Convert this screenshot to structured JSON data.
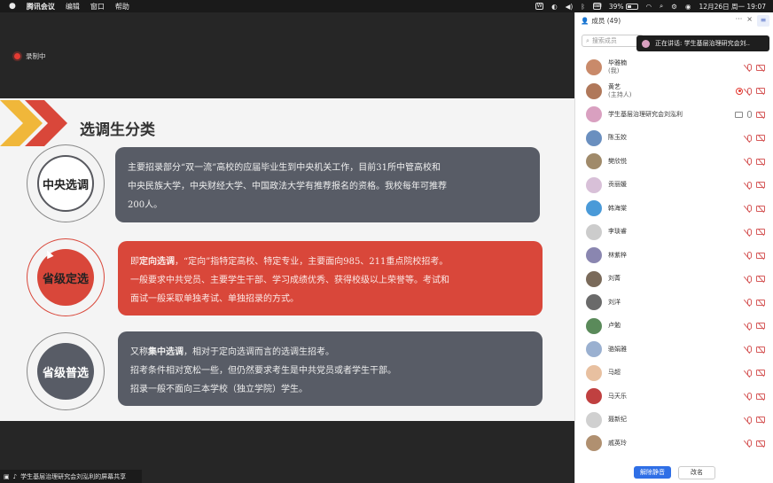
{
  "menubar": {
    "apple": "",
    "app": "腾讯会议",
    "items": [
      "编辑",
      "窗口",
      "帮助"
    ],
    "battery": "39%",
    "datetime": "12月26日 周一  19:07"
  },
  "recording": {
    "label": "录制中"
  },
  "slide": {
    "title": "选调生分类",
    "sections": [
      {
        "tag": "中央选调",
        "text_lines": [
          "主要招录部分“双一流”高校的应届毕业生到中央机关工作，目前31所中管高校和",
          "中央民族大学，中央财经大学、中国政法大学有推荐报名的资格。我校每年可推荐",
          "200人。"
        ]
      },
      {
        "tag": "省级定选",
        "prefix": "即",
        "em": "定向选调",
        "text_lines_rest": [
          "，“定向”指特定高校、特定专业，主要面向985、211重点院校招考。",
          "一般要求中共党员、主要学生干部、学习成绩优秀、获得校级以上荣誉等。考试和",
          "面试一般采取单独考试、单独招录的方式。"
        ]
      },
      {
        "tag": "省级普选",
        "prefix": "又称",
        "em": "集中选调",
        "text_lines_rest": [
          "，相对于定向选调而言的选调生招考。",
          "招考条件相对宽松一些，但仍然要求考生是中共党员或者学生干部。",
          "招录一般不面向三本学校（独立学院）学生。"
        ]
      }
    ]
  },
  "bottom_bar": {
    "label": "学生基层治理研究会刘泓利的屏幕共享"
  },
  "panel": {
    "title": "成员 (49)",
    "more": "···",
    "close": "×",
    "toggle": "≡",
    "search_placeholder": "搜索成员",
    "speaking": "正在讲话: 学生基层治理研究会刘..",
    "members": [
      {
        "name": "毕雅楠",
        "sub": "(我)",
        "color": "#c98a6a"
      },
      {
        "name": "黄艺",
        "sub": "(主持人)",
        "color": "#b0785a",
        "rec": true
      },
      {
        "name": "学生基层治理研究会刘泓利",
        "sub": "",
        "color": "#d9a0c0",
        "screen": true
      },
      {
        "name": "陈玉姣",
        "sub": "",
        "color": "#6a8fbf"
      },
      {
        "name": "樊欣悦",
        "sub": "",
        "color": "#a08a6a"
      },
      {
        "name": "贡丽媛",
        "sub": "",
        "color": "#d8c0d8"
      },
      {
        "name": "韩海棠",
        "sub": "",
        "color": "#4a9ad8"
      },
      {
        "name": "李琰睿",
        "sub": "",
        "color": "#cccccc"
      },
      {
        "name": "林紫梓",
        "sub": "",
        "color": "#8a86b0"
      },
      {
        "name": "刘菁",
        "sub": "",
        "color": "#7a6a5a"
      },
      {
        "name": "刘洋",
        "sub": "",
        "color": "#6a6a6a"
      },
      {
        "name": "卢勉",
        "sub": "",
        "color": "#5a8a5a"
      },
      {
        "name": "骆娟雅",
        "sub": "",
        "color": "#9ab0d0"
      },
      {
        "name": "马超",
        "sub": "",
        "color": "#e8c0a0"
      },
      {
        "name": "马天乐",
        "sub": "",
        "color": "#c04040"
      },
      {
        "name": "聂新纪",
        "sub": "",
        "color": "#d0d0d0"
      },
      {
        "name": "戚英玲",
        "sub": "",
        "color": "#b09070"
      }
    ],
    "unmute_all": "解除静音",
    "rename": "改名"
  },
  "colors": {
    "red": "#d9473a",
    "slate": "#585c66",
    "accent_blue": "#2f6fe6"
  }
}
